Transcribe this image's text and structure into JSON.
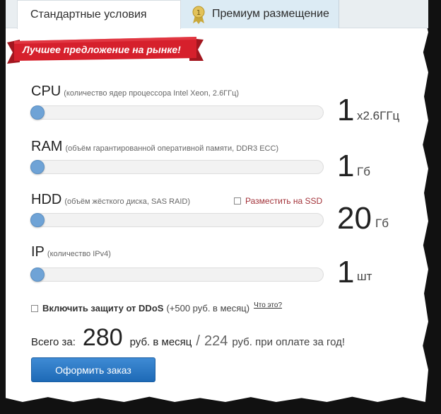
{
  "tabs": [
    {
      "label": "Стандартные условия"
    },
    {
      "label": "Премиум размещение"
    }
  ],
  "ribbon": {
    "text": "Лучшее предложение на рынке!"
  },
  "resources": {
    "cpu": {
      "name": "CPU",
      "desc": "(количество ядер процессора Intel Xeon, 2.6ГГц)",
      "value": "1",
      "unit": "x2.6ГГц"
    },
    "ram": {
      "name": "RAM",
      "desc": "(объём гарантированной оперативной памяти, DDR3 ECC)",
      "value": "1",
      "unit": "Гб"
    },
    "hdd": {
      "name": "HDD",
      "desc": "(объём жёсткого диска, SAS RAID)",
      "value": "20",
      "unit": "Гб",
      "ssd_label": "Разместить на SSD"
    },
    "ip": {
      "name": "IP",
      "desc": "(количество IPv4)",
      "value": "1",
      "unit": "шт"
    }
  },
  "ddos": {
    "label": "Включить защиту от DDoS",
    "price": "(+500 руб. в месяц)",
    "help_link": "Что это?"
  },
  "total": {
    "label": "Всего за:",
    "monthly_value": "280",
    "monthly_text": "руб. в месяц",
    "separator": "/",
    "yearly_value": "224",
    "yearly_text": "руб. при оплате за год!"
  },
  "order_button": {
    "label": "Оформить заказ"
  },
  "colors": {
    "accent": "#2a77c4",
    "ribbon": "#d6202c",
    "knob": "#6fa3d6"
  }
}
